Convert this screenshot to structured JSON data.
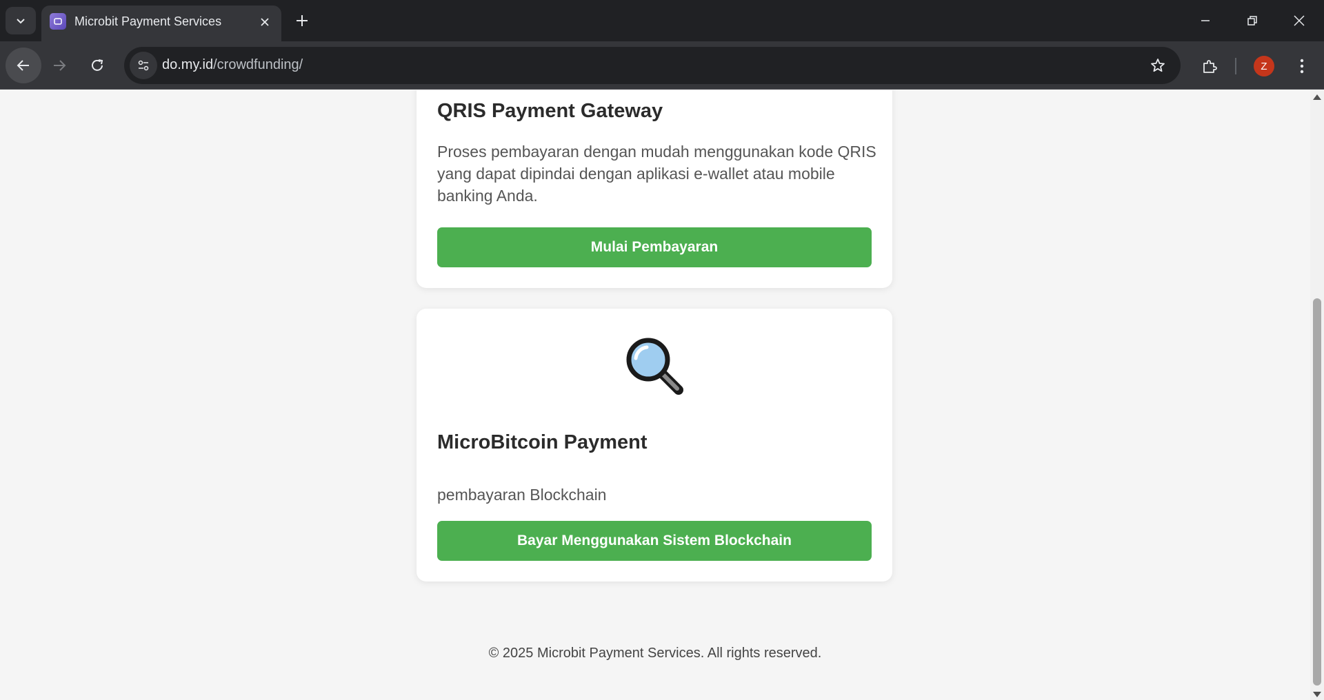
{
  "browser": {
    "tab_title": "Microbit Payment Services",
    "url_host": "do.my.id",
    "url_path": "/crowdfunding/",
    "avatar_letter": "Z"
  },
  "page": {
    "cards": [
      {
        "title": "QRIS Payment Gateway",
        "description": "Proses pembayaran dengan mudah menggunakan kode QRIS yang dapat dipindai dengan aplikasi e-wallet atau mobile banking Anda.",
        "button_label": "Mulai Pembayaran"
      },
      {
        "icon": "magnifying-glass-icon",
        "title": "MicroBitcoin Payment",
        "description": "pembayaran Blockchain",
        "button_label": "Bayar Menggunakan Sistem Blockchain"
      }
    ],
    "footer": "© 2025 Microbit Payment Services. All rights reserved."
  },
  "colors": {
    "accent_green": "#4caf50",
    "page_background": "#f5f5f5",
    "chrome_dark": "#202124"
  }
}
